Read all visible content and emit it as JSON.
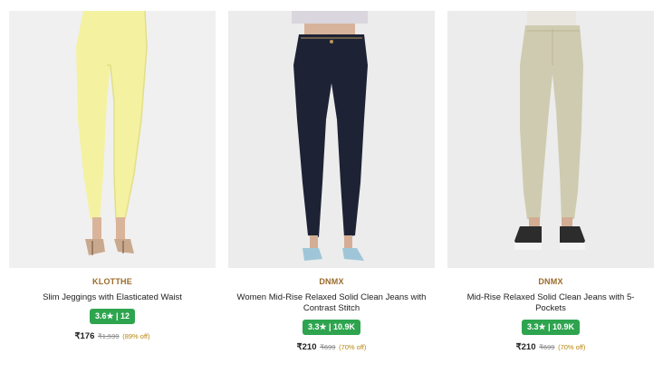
{
  "products": [
    {
      "brand": "KLOTTHE",
      "name": "Slim Jeggings with Elasticated Waist",
      "rating": "3.6★ | 12",
      "price": "₹176",
      "mrp": "₹1,599",
      "discount": "(89% off)",
      "image": {
        "kind": "yellow-jeggings-photo",
        "pant_color": "#f4f2a0",
        "background": "#f0f0f0"
      }
    },
    {
      "brand": "DNMX",
      "name": "Women Mid-Rise Relaxed Solid Clean Jeans with Contrast Stitch",
      "rating": "3.3★ | 10.9K",
      "price": "₹210",
      "mrp": "₹699",
      "discount": "(70% off)",
      "image": {
        "kind": "navy-jeans-photo",
        "pant_color": "#1d2235",
        "background": "#ececec"
      }
    },
    {
      "brand": "DNMX",
      "name": "Mid-Rise Relaxed Solid Clean Jeans with 5-Pockets",
      "rating": "3.3★ | 10.9K",
      "price": "₹210",
      "mrp": "₹699",
      "discount": "(70% off)",
      "image": {
        "kind": "beige-jeans-photo",
        "pant_color": "#cfcbb0",
        "background": "#ececec"
      }
    }
  ],
  "colors": {
    "brand": "#9a6b2a",
    "rating_bg": "#2ea44f",
    "discount": "#b8860b"
  }
}
